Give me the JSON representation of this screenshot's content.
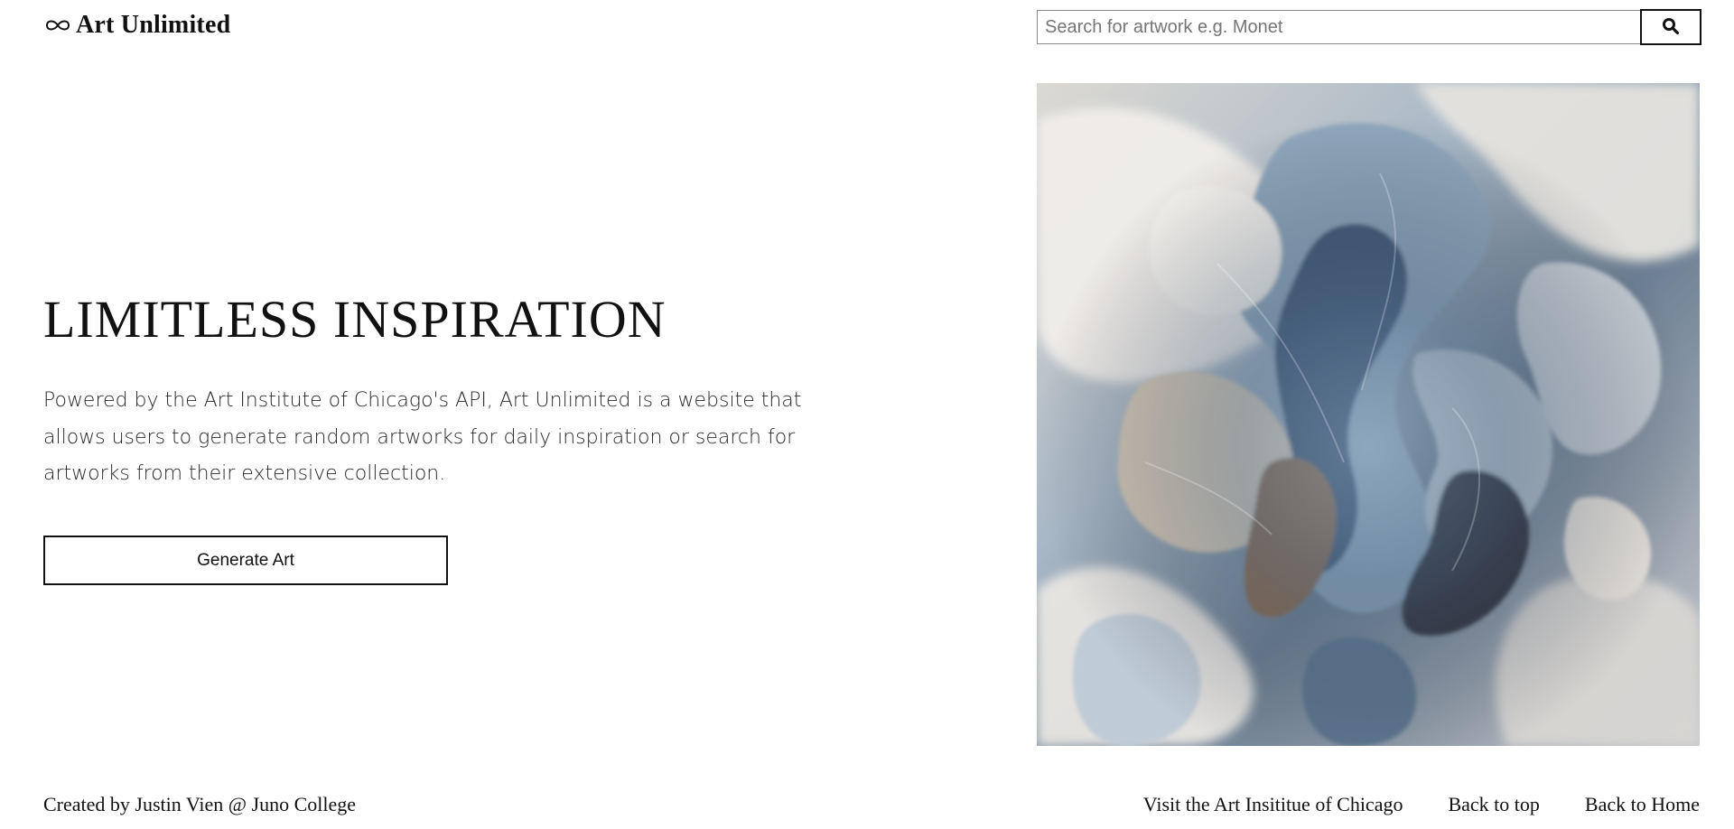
{
  "header": {
    "logo_text": "Art Unlimited",
    "logo_icon": "infinity-icon",
    "search": {
      "placeholder": "Search for artwork e.g. Monet",
      "value": "",
      "button_icon": "search-icon"
    }
  },
  "hero": {
    "title": "LIMITLESS INSPIRATION",
    "description": "Powered by the Art Institute of Chicago's API, Art Unlimited is a website that allows users to generate random artworks for daily inspiration or search for artworks from their extensive collection.",
    "generate_label": "Generate Art"
  },
  "artwork": {
    "palette": [
      "#e9e6e0",
      "#9fb3c8",
      "#4f6a86",
      "#8a6a4f",
      "#2b2a32",
      "#c9c2b6"
    ]
  },
  "footer": {
    "credit": "Created by Justin Vien @ Juno College",
    "links": [
      {
        "label": "Visit the Art Insititue of Chicago"
      },
      {
        "label": "Back to top"
      },
      {
        "label": "Back to Home"
      }
    ]
  }
}
